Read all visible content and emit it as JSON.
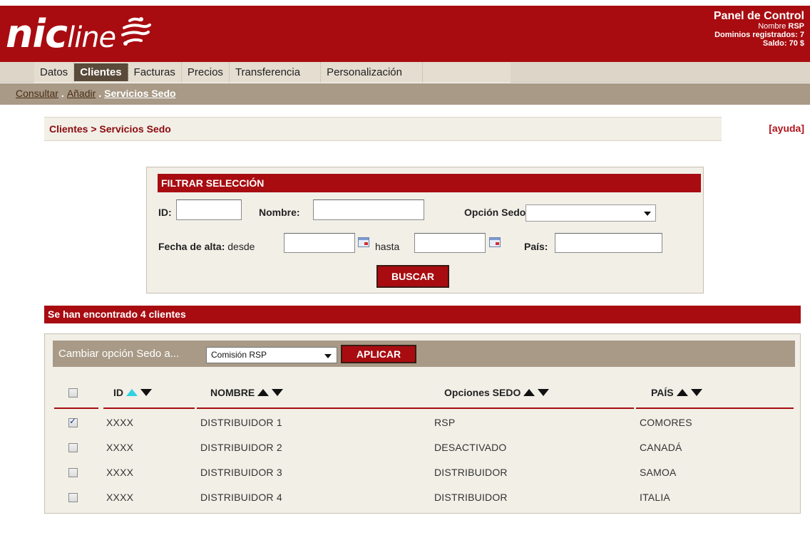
{
  "header": {
    "logo_bold": "nic",
    "logo_light": "line",
    "panel_title": "Panel de Control",
    "name_label": "Nombre",
    "name_value": "RSP",
    "domains_text": "Dominios registrados: 7",
    "balance_text": "Saldo: 70 $"
  },
  "nav": {
    "items": [
      {
        "label": "Datos"
      },
      {
        "label": "Clientes",
        "active": true
      },
      {
        "label": "Facturas"
      },
      {
        "label": "Precios"
      },
      {
        "label": "Transferencia"
      },
      {
        "label": "Personalización"
      }
    ]
  },
  "subnav": {
    "items": [
      {
        "label": "Consultar"
      },
      {
        "label": "Añadir"
      },
      {
        "label": "Servicios Sedo",
        "active": true
      }
    ],
    "separator": "."
  },
  "breadcrumb": {
    "text": "Clientes > Servicios Sedo",
    "help": "[ayuda]"
  },
  "filter": {
    "title": "FILTRAR SELECCIÓN",
    "id_label": "ID:",
    "nombre_label": "Nombre:",
    "opcion_label": "Opción Sedo:",
    "fecha_label": "Fecha de alta:",
    "desde_label": "desde",
    "hasta_label": "hasta",
    "pais_label": "País:",
    "id_value": "",
    "nombre_value": "",
    "opcion_value": "",
    "desde_value": "",
    "hasta_value": "",
    "pais_value": "",
    "search_button": "BUSCAR"
  },
  "results": {
    "summary": "Se han encontrado 4 clientes",
    "change_label": "Cambiar opción Sedo a...",
    "change_value": "Comisión RSP",
    "apply_button": "APLICAR",
    "columns": [
      "ID",
      "NOMBRE",
      "Opciones SEDO",
      "PAÍS"
    ],
    "sorted_column": "ID",
    "sort_direction": "asc",
    "sort_highlight_color": "#2fd2e2",
    "rows": [
      {
        "checked": true,
        "id": "XXXX",
        "nombre": "DISTRIBUIDOR 1",
        "opcion": "RSP",
        "pais": "COMORES"
      },
      {
        "checked": false,
        "id": "XXXX",
        "nombre": "DISTRIBUIDOR 2",
        "opcion": "DESACTIVADO",
        "pais": "CANADÁ"
      },
      {
        "checked": false,
        "id": "XXXX",
        "nombre": "DISTRIBUIDOR 3",
        "opcion": "DISTRIBUIDOR",
        "pais": "SAMOA"
      },
      {
        "checked": false,
        "id": "XXXX",
        "nombre": "DISTRIBUIDOR 4",
        "opcion": "DISTRIBUIDOR",
        "pais": "ITALIA"
      }
    ]
  },
  "colors": {
    "brand_red": "#a80c10",
    "nav_bg": "#ddd6c8",
    "subnav_bg": "#a89a86",
    "panel_bg": "#f2efe7"
  }
}
